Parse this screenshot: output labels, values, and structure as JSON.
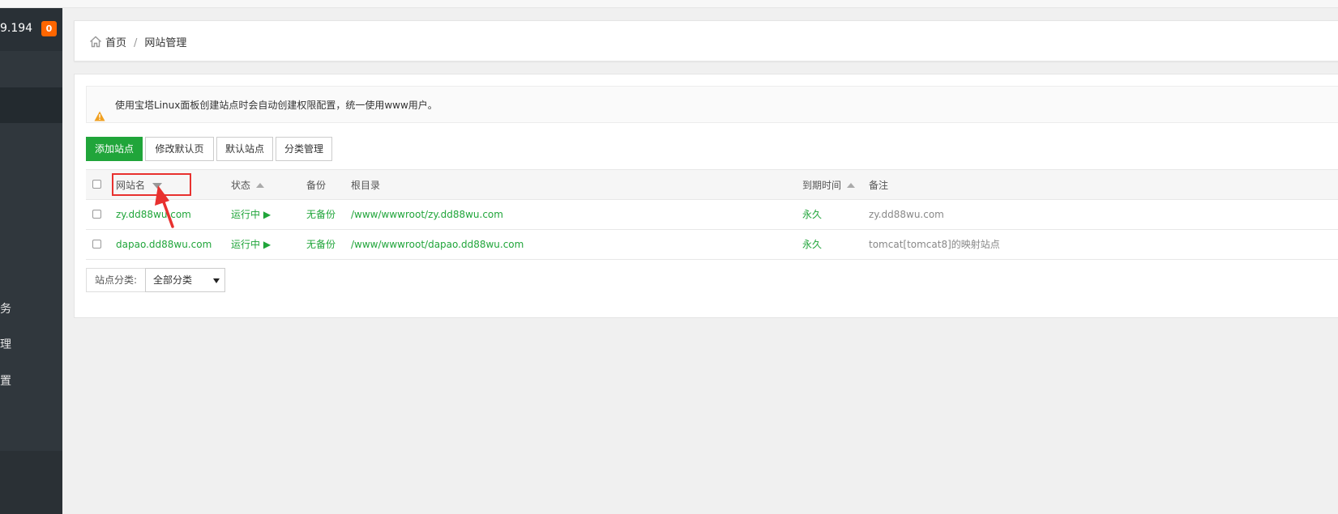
{
  "sidebar": {
    "ip_text": "9.194",
    "badge": "0",
    "items": [
      {
        "label": "务"
      },
      {
        "label": "理"
      },
      {
        "label": "置"
      }
    ]
  },
  "breadcrumb": {
    "home": "首页",
    "separator": "/",
    "current": "网站管理"
  },
  "notice": {
    "text": "使用宝塔Linux面板创建站点时会自动创建权限配置，统一使用www用户。"
  },
  "toolbar": {
    "add_site": "添加站点",
    "edit_default_page": "修改默认页",
    "default_site": "默认站点",
    "category_manage": "分类管理"
  },
  "table": {
    "headers": {
      "name": "网站名",
      "status": "状态",
      "backup": "备份",
      "root": "根目录",
      "expire": "到期时间",
      "remark": "备注"
    },
    "rows": [
      {
        "name": "zy.dd88wu.com",
        "status": "运行中 ▶",
        "backup": "无备份",
        "root": "/www/wwwroot/zy.dd88wu.com",
        "expire": "永久",
        "remark": "zy.dd88wu.com"
      },
      {
        "name": "dapao.dd88wu.com",
        "status": "运行中 ▶",
        "backup": "无备份",
        "root": "/www/wwwroot/dapao.dd88wu.com",
        "expire": "永久",
        "remark": "tomcat[tomcat8]的映射站点"
      }
    ]
  },
  "filter": {
    "label": "站点分类:",
    "selected": "全部分类"
  },
  "colors": {
    "accent_green": "#20a53a",
    "sidebar_bg": "#30373d",
    "badge_orange": "#ff6600",
    "annotation_red": "#e8312f",
    "warning_orange": "#f0a020"
  }
}
